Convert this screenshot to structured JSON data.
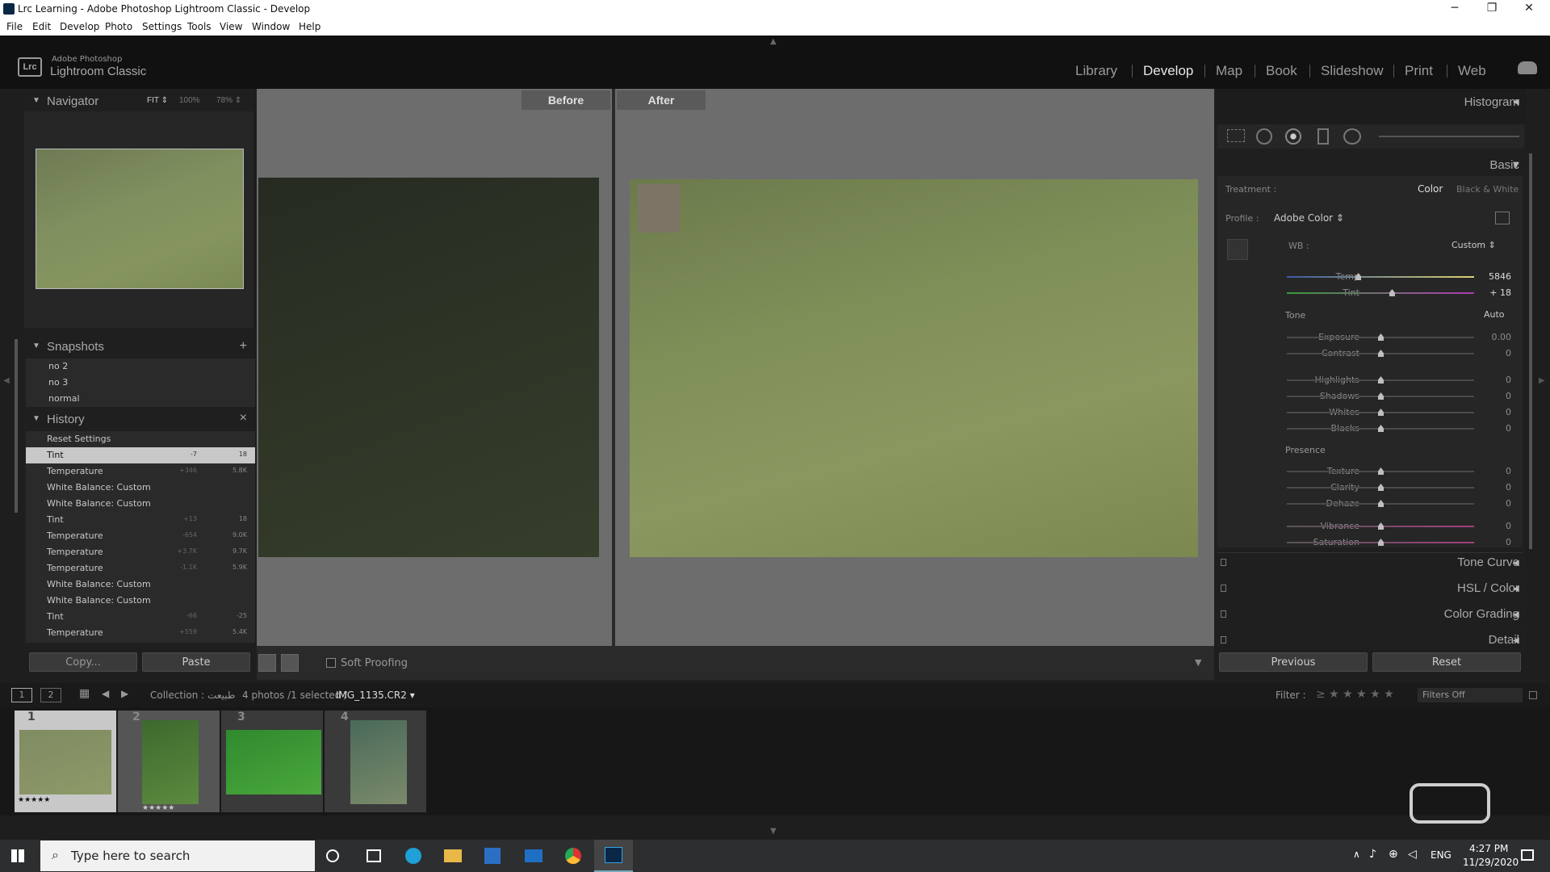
{
  "window": {
    "title": "Lrc Learning - Adobe Photoshop Lightroom Classic - Develop",
    "controls": [
      "─",
      "❐",
      "✕"
    ]
  },
  "menu": [
    "File",
    "Edit",
    "Develop",
    "Photo",
    "Settings",
    "Tools",
    "View",
    "Window",
    "Help"
  ],
  "identity": {
    "logo": "Lrc",
    "line1": "Adobe Photoshop",
    "line2": "Lightroom Classic"
  },
  "modules": [
    "Library",
    "Develop",
    "Map",
    "Book",
    "Slideshow",
    "Print",
    "Web"
  ],
  "active_module": "Develop",
  "navigator": {
    "title": "Navigator",
    "zoom": [
      "FIT ⇕",
      "100%",
      "78% ⇕"
    ]
  },
  "snapshots": {
    "title": "Snapshots",
    "add": "+",
    "items": [
      "no 2",
      "no 3",
      "normal"
    ]
  },
  "history": {
    "title": "History",
    "close": "×",
    "items": [
      {
        "name": "Reset Settings",
        "a": "",
        "b": ""
      },
      {
        "name": "Tint",
        "a": "-7",
        "b": "18"
      },
      {
        "name": "Temperature",
        "a": "+346",
        "b": "5.8K"
      },
      {
        "name": "White Balance: Custom",
        "a": "",
        "b": ""
      },
      {
        "name": "White Balance: Custom",
        "a": "",
        "b": ""
      },
      {
        "name": "Tint",
        "a": "+13",
        "b": "18"
      },
      {
        "name": "Temperature",
        "a": "-654",
        "b": "9.0K"
      },
      {
        "name": "Temperature",
        "a": "+3.7K",
        "b": "9.7K"
      },
      {
        "name": "Temperature",
        "a": "-1.1K",
        "b": "5.9K"
      },
      {
        "name": "White Balance: Custom",
        "a": "",
        "b": ""
      },
      {
        "name": "White Balance: Custom",
        "a": "",
        "b": ""
      },
      {
        "name": "Tint",
        "a": "-66",
        "b": "-25"
      },
      {
        "name": "Temperature",
        "a": "+559",
        "b": "5.4K"
      }
    ]
  },
  "left_buttons": {
    "copy": "Copy...",
    "paste": "Paste"
  },
  "compare": {
    "before": "Before",
    "after": "After"
  },
  "toolbar": {
    "soft_proofing": "Soft Proofing"
  },
  "right": {
    "histogram": "Histogram",
    "basic": "Basic",
    "treatment_label": "Treatment :",
    "treatment_color": "Color",
    "treatment_bw": "Black & White",
    "profile_label": "Profile :",
    "profile_value": "Adobe Color ⇕",
    "wb_label": "WB :",
    "wb_value": "Custom ⇕",
    "tone_label": "Tone",
    "auto": "Auto",
    "presence_label": "Presence",
    "sliders": [
      {
        "label": "Temp",
        "value": "5846",
        "pos": 0.38
      },
      {
        "label": "Tint",
        "value": "+ 18",
        "pos": 0.56
      },
      {
        "label": "Exposure",
        "value": "0.00",
        "pos": 0.5
      },
      {
        "label": "Contrast",
        "value": "0",
        "pos": 0.5
      },
      {
        "label": "Highlights",
        "value": "0",
        "pos": 0.5
      },
      {
        "label": "Shadows",
        "value": "0",
        "pos": 0.5
      },
      {
        "label": "Whites",
        "value": "0",
        "pos": 0.5
      },
      {
        "label": "Blacks",
        "value": "0",
        "pos": 0.5
      },
      {
        "label": "Texture",
        "value": "0",
        "pos": 0.5
      },
      {
        "label": "Clarity",
        "value": "0",
        "pos": 0.5
      },
      {
        "label": "Dehaze",
        "value": "0",
        "pos": 0.5
      },
      {
        "label": "Vibrance",
        "value": "0",
        "pos": 0.5
      },
      {
        "label": "Saturation",
        "value": "0",
        "pos": 0.5
      }
    ],
    "tone_curve": "Tone Curve",
    "hsl": "HSL / Color",
    "color_grading": "Color Grading",
    "detail": "Detail",
    "previous": "Previous",
    "reset": "Reset"
  },
  "filmbar": {
    "page1": "1",
    "page2": "2",
    "collection": "Collection : طبیعت",
    "info": "4 photos /1 selected /",
    "file": "IMG_1135.CR2 ▾",
    "filter_label": "Filter :",
    "stars": "≥ ★ ★ ★ ★ ★",
    "filters_off": "Filters Off"
  },
  "thumbs": [
    {
      "num": "1",
      "stars": "★★★★★"
    },
    {
      "num": "2",
      "stars": "★★★★★"
    },
    {
      "num": "3",
      "stars": ""
    },
    {
      "num": "4",
      "stars": ""
    }
  ],
  "taskbar": {
    "search": "Type here to search",
    "lang": "ENG",
    "time": "4:27 PM",
    "date": "11/29/2020"
  },
  "colors": {
    "accent": "#3a8edb",
    "panel": "#1f1f1f",
    "center_bg": "#6d6d6d"
  }
}
